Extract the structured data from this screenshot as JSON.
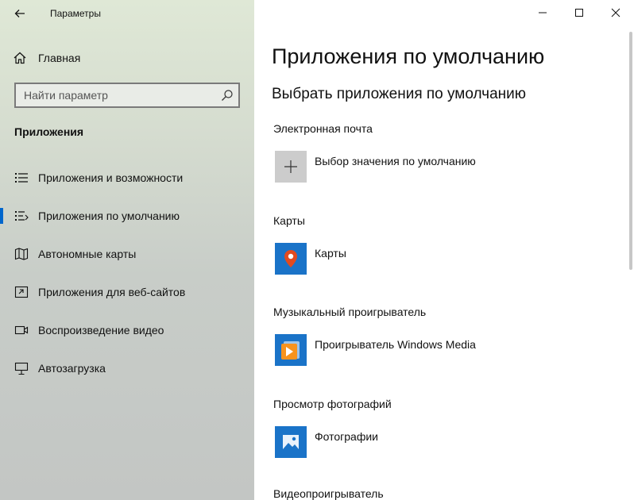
{
  "window": {
    "title": "Параметры"
  },
  "sidebar": {
    "home_label": "Главная",
    "search_placeholder": "Найти параметр",
    "section_title": "Приложения",
    "items": [
      {
        "label": "Приложения и возможности",
        "icon": "list-icon",
        "active": false
      },
      {
        "label": "Приложения по умолчанию",
        "icon": "default-apps-icon",
        "active": true
      },
      {
        "label": "Автономные карты",
        "icon": "map-icon",
        "active": false
      },
      {
        "label": "Приложения для веб-сайтов",
        "icon": "web-apps-icon",
        "active": false
      },
      {
        "label": "Воспроизведение видео",
        "icon": "video-icon",
        "active": false
      },
      {
        "label": "Автозагрузка",
        "icon": "startup-icon",
        "active": false
      }
    ]
  },
  "main": {
    "title": "Приложения по умолчанию",
    "subtitle": "Выбрать приложения по умолчанию",
    "categories": [
      {
        "label": "Электронная почта",
        "app": "Выбор значения по умолчанию",
        "icon": "plus-icon"
      },
      {
        "label": "Карты",
        "app": "Карты",
        "icon": "maps-pin-icon"
      },
      {
        "label": "Музыкальный проигрыватель",
        "app": "Проигрыватель Windows Media",
        "icon": "windows-media-player-icon"
      },
      {
        "label": "Просмотр фотографий",
        "app": "Фотографии",
        "icon": "photos-icon"
      },
      {
        "label": "Видеопроигрыватель"
      }
    ]
  },
  "colors": {
    "accent": "#0066cc",
    "tile_blue": "#1a73c8",
    "tile_gray": "#cccccc"
  }
}
